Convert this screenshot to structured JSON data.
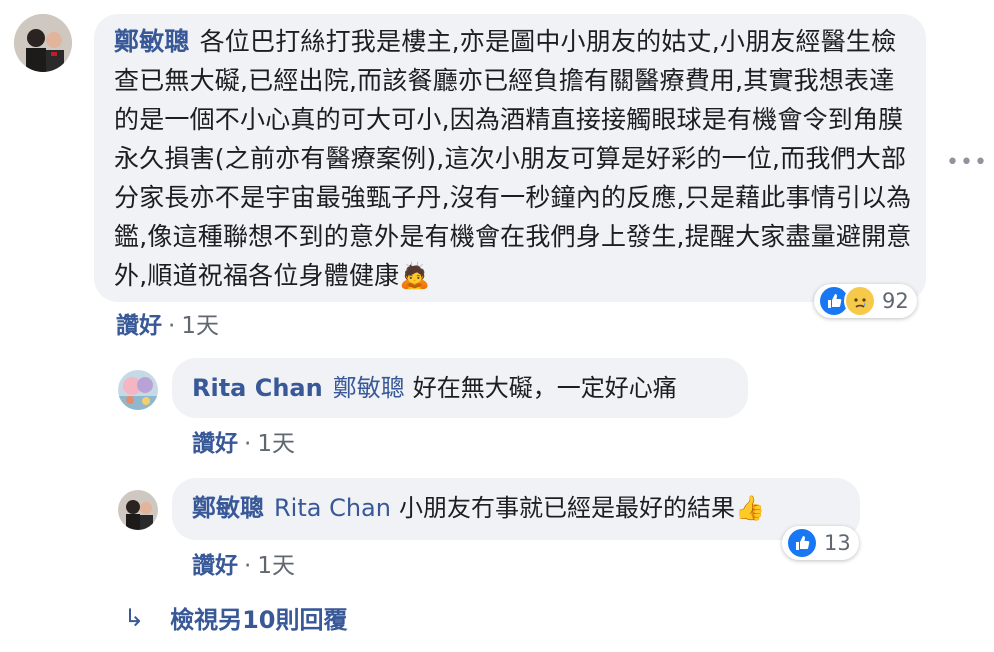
{
  "comment": {
    "author": "鄭敏聰",
    "text": "各位巴打絲打我是樓主,亦是圖中小朋友的姑丈,小朋友經醫生檢查已無大礙,已經出院,而該餐廳亦已經負擔有關醫療費用,其實我想表達的是一個不小心真的可大可小,因為酒精直接接觸眼球是有機會令到角膜永久損害(之前亦有醫療案例),這次小朋友可算是好彩的一位,而我們大部分家長亦不是宇宙最強甄子丹,沒有一秒鐘內的反應,只是藉此事情引以為鑑,像這種聯想不到的意外是有機會在我們身上發生,提醒大家盡量避開意外,順道祝福各位身體健康",
    "emoji": "🙇",
    "like_label": "讚好",
    "time": "1天",
    "reaction_count": "92",
    "more_label": "•••"
  },
  "replies": [
    {
      "author": "Rita Chan",
      "mention": "鄭敏聰",
      "text": "好在無大礙，一定好心痛",
      "like_label": "讚好",
      "time": "1天"
    },
    {
      "author": "鄭敏聰",
      "mention": "Rita Chan",
      "text": "小朋友冇事就已經是最好的結果",
      "emoji": "👍",
      "like_label": "讚好",
      "time": "1天",
      "reaction_count": "13"
    }
  ],
  "view_more": {
    "arrow": "↳",
    "label": "檢視另10則回覆"
  },
  "colors": {
    "link": "#385898",
    "bubble": "#f0f2f5",
    "like_blue": "#1877f2"
  }
}
